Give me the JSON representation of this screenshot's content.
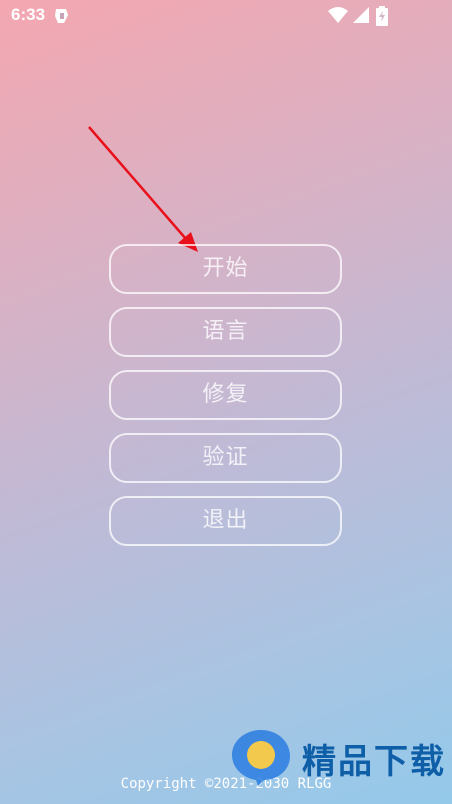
{
  "status_bar": {
    "time": "6:33",
    "icons": [
      "app-notification-icon",
      "wifi-icon",
      "cell-signal-icon",
      "battery-charging-icon"
    ]
  },
  "menu": {
    "items": [
      {
        "label": "开始"
      },
      {
        "label": "语言"
      },
      {
        "label": "修复"
      },
      {
        "label": "验证"
      },
      {
        "label": "退出"
      }
    ]
  },
  "footer": {
    "copyright": "Copyright ©2021-2030 RLGG"
  },
  "watermark": {
    "text": "精品下载"
  },
  "colors": {
    "gradient_top": "#f4a7b0",
    "gradient_bottom": "#94c9ea",
    "button_border": "#ffffff",
    "arrow": "#e8101a",
    "watermark": "#0f5fa8"
  }
}
